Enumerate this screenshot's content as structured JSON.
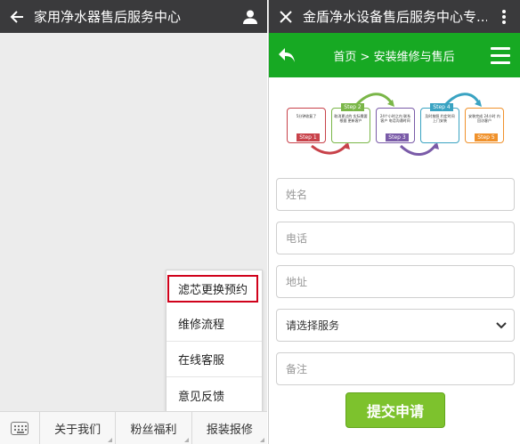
{
  "left_pane": {
    "title": "家用净水器售后服务中心",
    "popup_menu": [
      {
        "label": "滤芯更换预约",
        "highlighted": true
      },
      {
        "label": "维修流程"
      },
      {
        "label": "在线客服"
      },
      {
        "label": "意见反馈"
      }
    ],
    "bottom_menu": [
      {
        "label": "关于我们"
      },
      {
        "label": "粉丝福利"
      },
      {
        "label": "报装报修"
      }
    ]
  },
  "right_pane": {
    "title": "金盾净水设备售后服务中心专...",
    "breadcrumb": "首页 > 安装维修与售后",
    "steps": [
      {
        "tag": "Step 1",
        "text": "5分钟收复了",
        "color": "#c8424a"
      },
      {
        "tag": "Step 2",
        "text": "取消更过的 实际需要根据 更新客户",
        "color": "#7ab648"
      },
      {
        "tag": "Step 3",
        "text": "24个小时之内 联系客户 电话沟通时间",
        "color": "#7a5ba8"
      },
      {
        "tag": "Step 4",
        "text": "及时按照 约定时间 上门安装",
        "color": "#3aa3c2"
      },
      {
        "tag": "Step 5",
        "text": "安装完成 24小时 内回访客户",
        "color": "#f0922c"
      }
    ],
    "form": {
      "name_placeholder": "姓名",
      "phone_placeholder": "电话",
      "address_placeholder": "地址",
      "service_select": "请选择服务",
      "notes_placeholder": "备注",
      "submit_label": "提交申请"
    },
    "colors": {
      "brand_green": "#17a923",
      "submit_green": "#7dc22d",
      "highlight_red": "#d0021b"
    }
  }
}
